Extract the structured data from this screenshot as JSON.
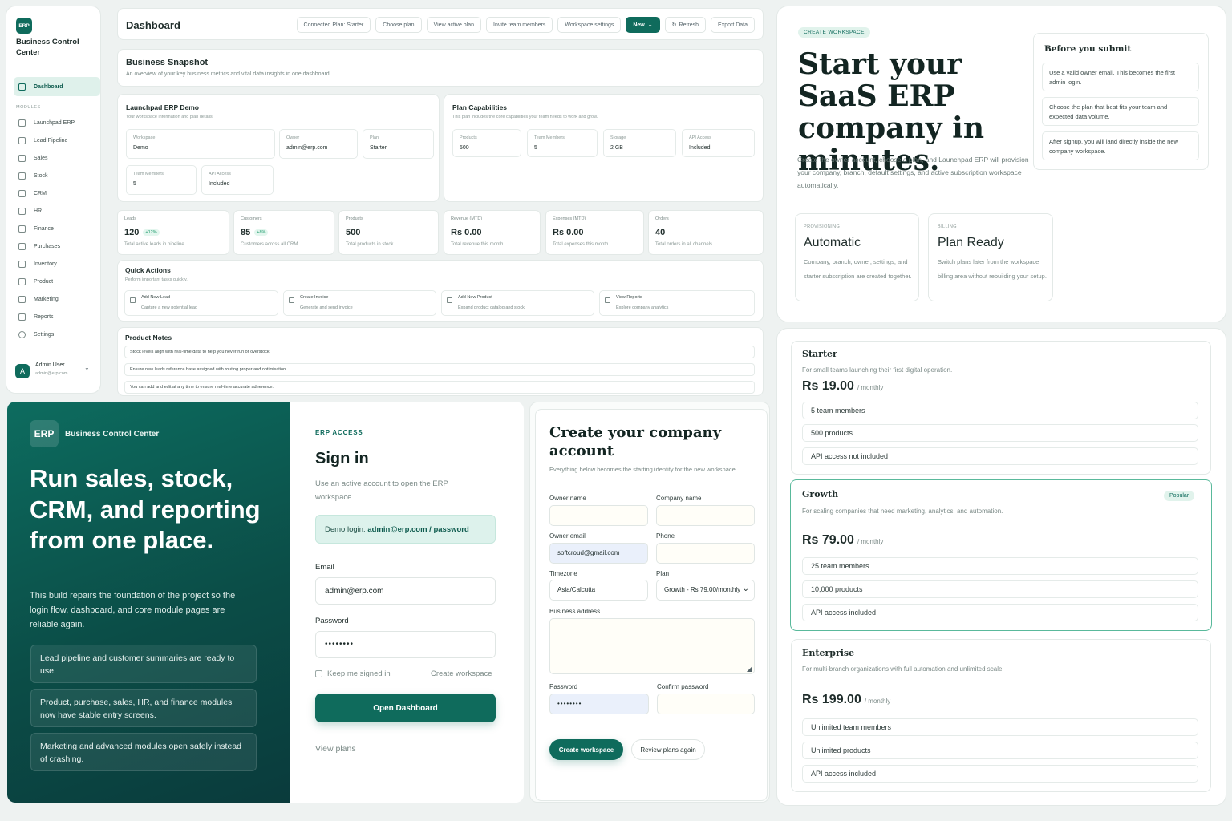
{
  "sidebar": {
    "logo": "ERP",
    "title": "Business Control Center",
    "active": "Dashboard",
    "section": "MODULES",
    "items": [
      "Launchpad ERP",
      "Lead Pipeline",
      "Sales",
      "Stock",
      "CRM",
      "HR",
      "Finance",
      "Purchases",
      "Inventory",
      "Product",
      "Marketing",
      "Reports",
      "Settings"
    ],
    "user": {
      "initial": "A",
      "name": "Admin User",
      "email": "admin@erp.com"
    }
  },
  "header": {
    "title": "Dashboard",
    "buttons": [
      "Connected Plan: Starter",
      "Choose plan",
      "View active plan",
      "Invite team members",
      "Workspace settings"
    ],
    "new_label": "New",
    "refresh_label": "Refresh",
    "export_label": "Export Data"
  },
  "snapshot": {
    "title": "Business Snapshot",
    "subtitle": "An overview of your key business metrics and vital data insights in one dashboard."
  },
  "demo": {
    "title": "Launchpad ERP Demo",
    "subtitle": "Your workspace information and plan details.",
    "fields": [
      {
        "label": "Workspace",
        "value": "Demo"
      },
      {
        "label": "Owner",
        "value": "admin@erp.com"
      },
      {
        "label": "Plan",
        "value": "Starter"
      },
      {
        "label": "Team Members",
        "value": "5"
      },
      {
        "label": "API Access",
        "value": "Included"
      }
    ]
  },
  "capabilities": {
    "title": "Plan Capabilities",
    "subtitle": "This plan includes the core capabilities your team needs to work and grow.",
    "fields": [
      {
        "label": "Products",
        "value": "500"
      },
      {
        "label": "Team Members",
        "value": "5"
      },
      {
        "label": "Storage",
        "value": "2 GB"
      },
      {
        "label": "API Access",
        "value": "Included"
      }
    ]
  },
  "kpis": [
    {
      "title": "Leads",
      "value": "120",
      "chip": "+12%",
      "desc": "Total active leads in pipeline"
    },
    {
      "title": "Customers",
      "value": "85",
      "chip": "+8%",
      "desc": "Customers across all CRM"
    },
    {
      "title": "Products",
      "value": "500",
      "chip": "",
      "desc": "Total products in stock"
    },
    {
      "title": "Revenue (MTD)",
      "value": "Rs 0.00",
      "chip": "",
      "desc": "Total revenue this month"
    },
    {
      "title": "Expenses (MTD)",
      "value": "Rs 0.00",
      "chip": "",
      "desc": "Total expenses this month"
    },
    {
      "title": "Orders",
      "value": "40",
      "chip": "",
      "desc": "Total orders in all channels"
    }
  ],
  "quick": {
    "title": "Quick Actions",
    "subtitle": "Perform important tasks quickly.",
    "items": [
      {
        "title": "Add New Lead",
        "desc": "Capture a new potential lead"
      },
      {
        "title": "Create Invoice",
        "desc": "Generate and send invoice"
      },
      {
        "title": "Add New Product",
        "desc": "Expand product catalog and stock"
      },
      {
        "title": "View Reports",
        "desc": "Explore company analytics"
      }
    ]
  },
  "notes": {
    "title": "Product Notes",
    "items": [
      "Stock levels align with real-time data to help you never run or overstock.",
      "Ensure new leads reference base assigned with routing proper and optimisation.",
      "You can add and edit at any time to ensure real-time accurate adherence."
    ]
  },
  "hero": {
    "badge": "CREATE WORKSPACE",
    "title": "Start your SaaS ERP company in minutes.",
    "desc": "Create the owner account, choose a plan, and Launchpad ERP will provision your company, branch, default settings, and active subscription workspace automatically.",
    "cards": [
      {
        "tag": "PROVISIONING",
        "title": "Automatic",
        "desc": "Company, branch, owner, settings, and starter subscription are created together."
      },
      {
        "tag": "BILLING",
        "title": "Plan Ready",
        "desc": "Switch plans later from the workspace billing area without rebuilding your setup."
      }
    ]
  },
  "before": {
    "title": "Before you submit",
    "items": [
      "Use a valid owner email. This becomes the first admin login.",
      "Choose the plan that best fits your team and expected data volume.",
      "After signup, you will land directly inside the new company workspace."
    ]
  },
  "plans": [
    {
      "name": "Starter",
      "desc": "For small teams launching their first digital operation.",
      "price": "Rs 19.00",
      "period": "/ monthly",
      "badge": "",
      "features": [
        "5 team members",
        "500 products",
        "API access not included"
      ]
    },
    {
      "name": "Growth",
      "desc": "For scaling companies that need marketing, analytics, and automation.",
      "price": "Rs 79.00",
      "period": "/ monthly",
      "badge": "Popular",
      "features": [
        "25 team members",
        "10,000 products",
        "API access included"
      ]
    },
    {
      "name": "Enterprise",
      "desc": "For multi-branch organizations with full automation and unlimited scale.",
      "price": "Rs 199.00",
      "period": "/ monthly",
      "badge": "",
      "features": [
        "Unlimited team members",
        "Unlimited products",
        "API access included"
      ]
    }
  ],
  "promo": {
    "logo": "ERP",
    "brand": "Business Control Center",
    "headline": "Run sales, stock, CRM, and reporting from one place.",
    "desc": "This build repairs the foundation of the project so the login flow, dashboard, and core module pages are reliable again.",
    "highlights": [
      "Lead pipeline and customer summaries are ready to use.",
      "Product, purchase, sales, HR, and finance modules now have stable entry screens.",
      "Marketing and advanced modules open safely instead of crashing."
    ]
  },
  "signin": {
    "eyebrow": "ERP ACCESS",
    "title": "Sign in",
    "desc": "Use an active account to open the ERP workspace.",
    "demo_prefix": "Demo login: ",
    "demo_creds": "admin@erp.com / password",
    "email_label": "Email",
    "email_value": "admin@erp.com",
    "password_label": "Password",
    "password_value": "••••••••",
    "remember": "Keep me signed in",
    "create_link": "Create workspace",
    "submit": "Open Dashboard",
    "plans_link": "View plans"
  },
  "create": {
    "title": "Create your company account",
    "desc": "Everything below becomes the starting identity for the new workspace.",
    "owner_name_label": "Owner name",
    "company_name_label": "Company name",
    "owner_email_label": "Owner email",
    "owner_email_value": "softcroud@gmail.com",
    "phone_label": "Phone",
    "timezone_label": "Timezone",
    "timezone_value": "Asia/Calcutta",
    "plan_label": "Plan",
    "plan_value": "Growth - Rs 79.00/monthly",
    "address_label": "Business address",
    "password_label": "Password",
    "password_value": "••••••••",
    "confirm_label": "Confirm password",
    "submit": "Create workspace",
    "review": "Review plans again"
  }
}
